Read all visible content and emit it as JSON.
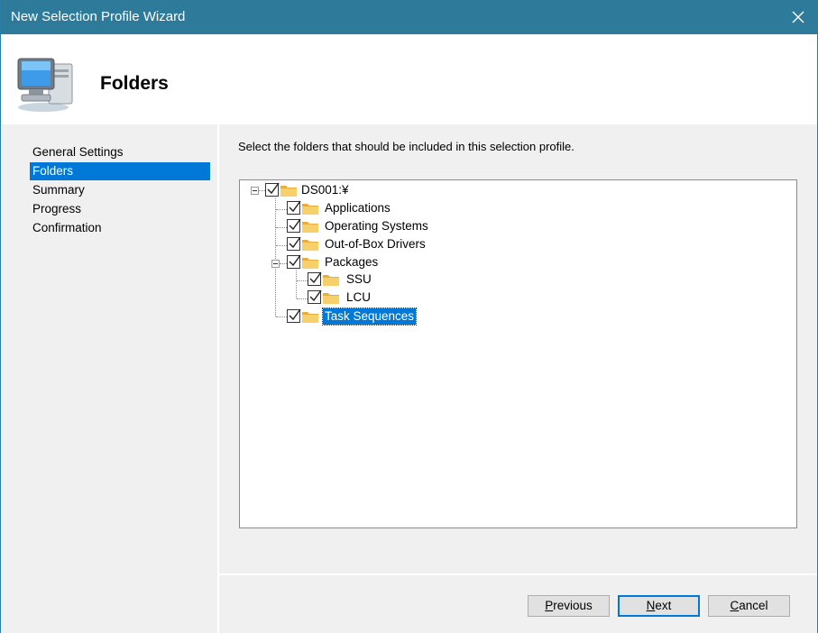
{
  "window": {
    "title": "New Selection Profile Wizard"
  },
  "header": {
    "heading": "Folders",
    "icon": "computer-icon"
  },
  "sidebar": {
    "items": [
      {
        "label": "General Settings",
        "selected": false
      },
      {
        "label": "Folders",
        "selected": true
      },
      {
        "label": "Summary",
        "selected": false
      },
      {
        "label": "Progress",
        "selected": false
      },
      {
        "label": "Confirmation",
        "selected": false
      }
    ]
  },
  "main": {
    "instruction": "Select the folders that should be included in this selection profile.",
    "tree": [
      {
        "label": "DS001:¥",
        "checked": true,
        "depth": 0,
        "expanded": true
      },
      {
        "label": "Applications",
        "checked": true,
        "depth": 1
      },
      {
        "label": "Operating Systems",
        "checked": true,
        "depth": 1
      },
      {
        "label": "Out-of-Box Drivers",
        "checked": true,
        "depth": 1
      },
      {
        "label": "Packages",
        "checked": true,
        "depth": 1,
        "expanded": true
      },
      {
        "label": "SSU",
        "checked": true,
        "depth": 2
      },
      {
        "label": "LCU",
        "checked": true,
        "depth": 2
      },
      {
        "label": "Task Sequences",
        "checked": true,
        "depth": 1,
        "selected": true
      }
    ]
  },
  "footer": {
    "previous": {
      "mnemonic": "P",
      "rest": "revious"
    },
    "next": {
      "mnemonic": "N",
      "rest": "ext"
    },
    "cancel": {
      "mnemonic": "C",
      "rest": "ancel"
    }
  },
  "colors": {
    "titlebar": "#2e7a9b",
    "selection": "#0078d7",
    "panel": "#f0f0f0",
    "folder": "#f5c451"
  }
}
